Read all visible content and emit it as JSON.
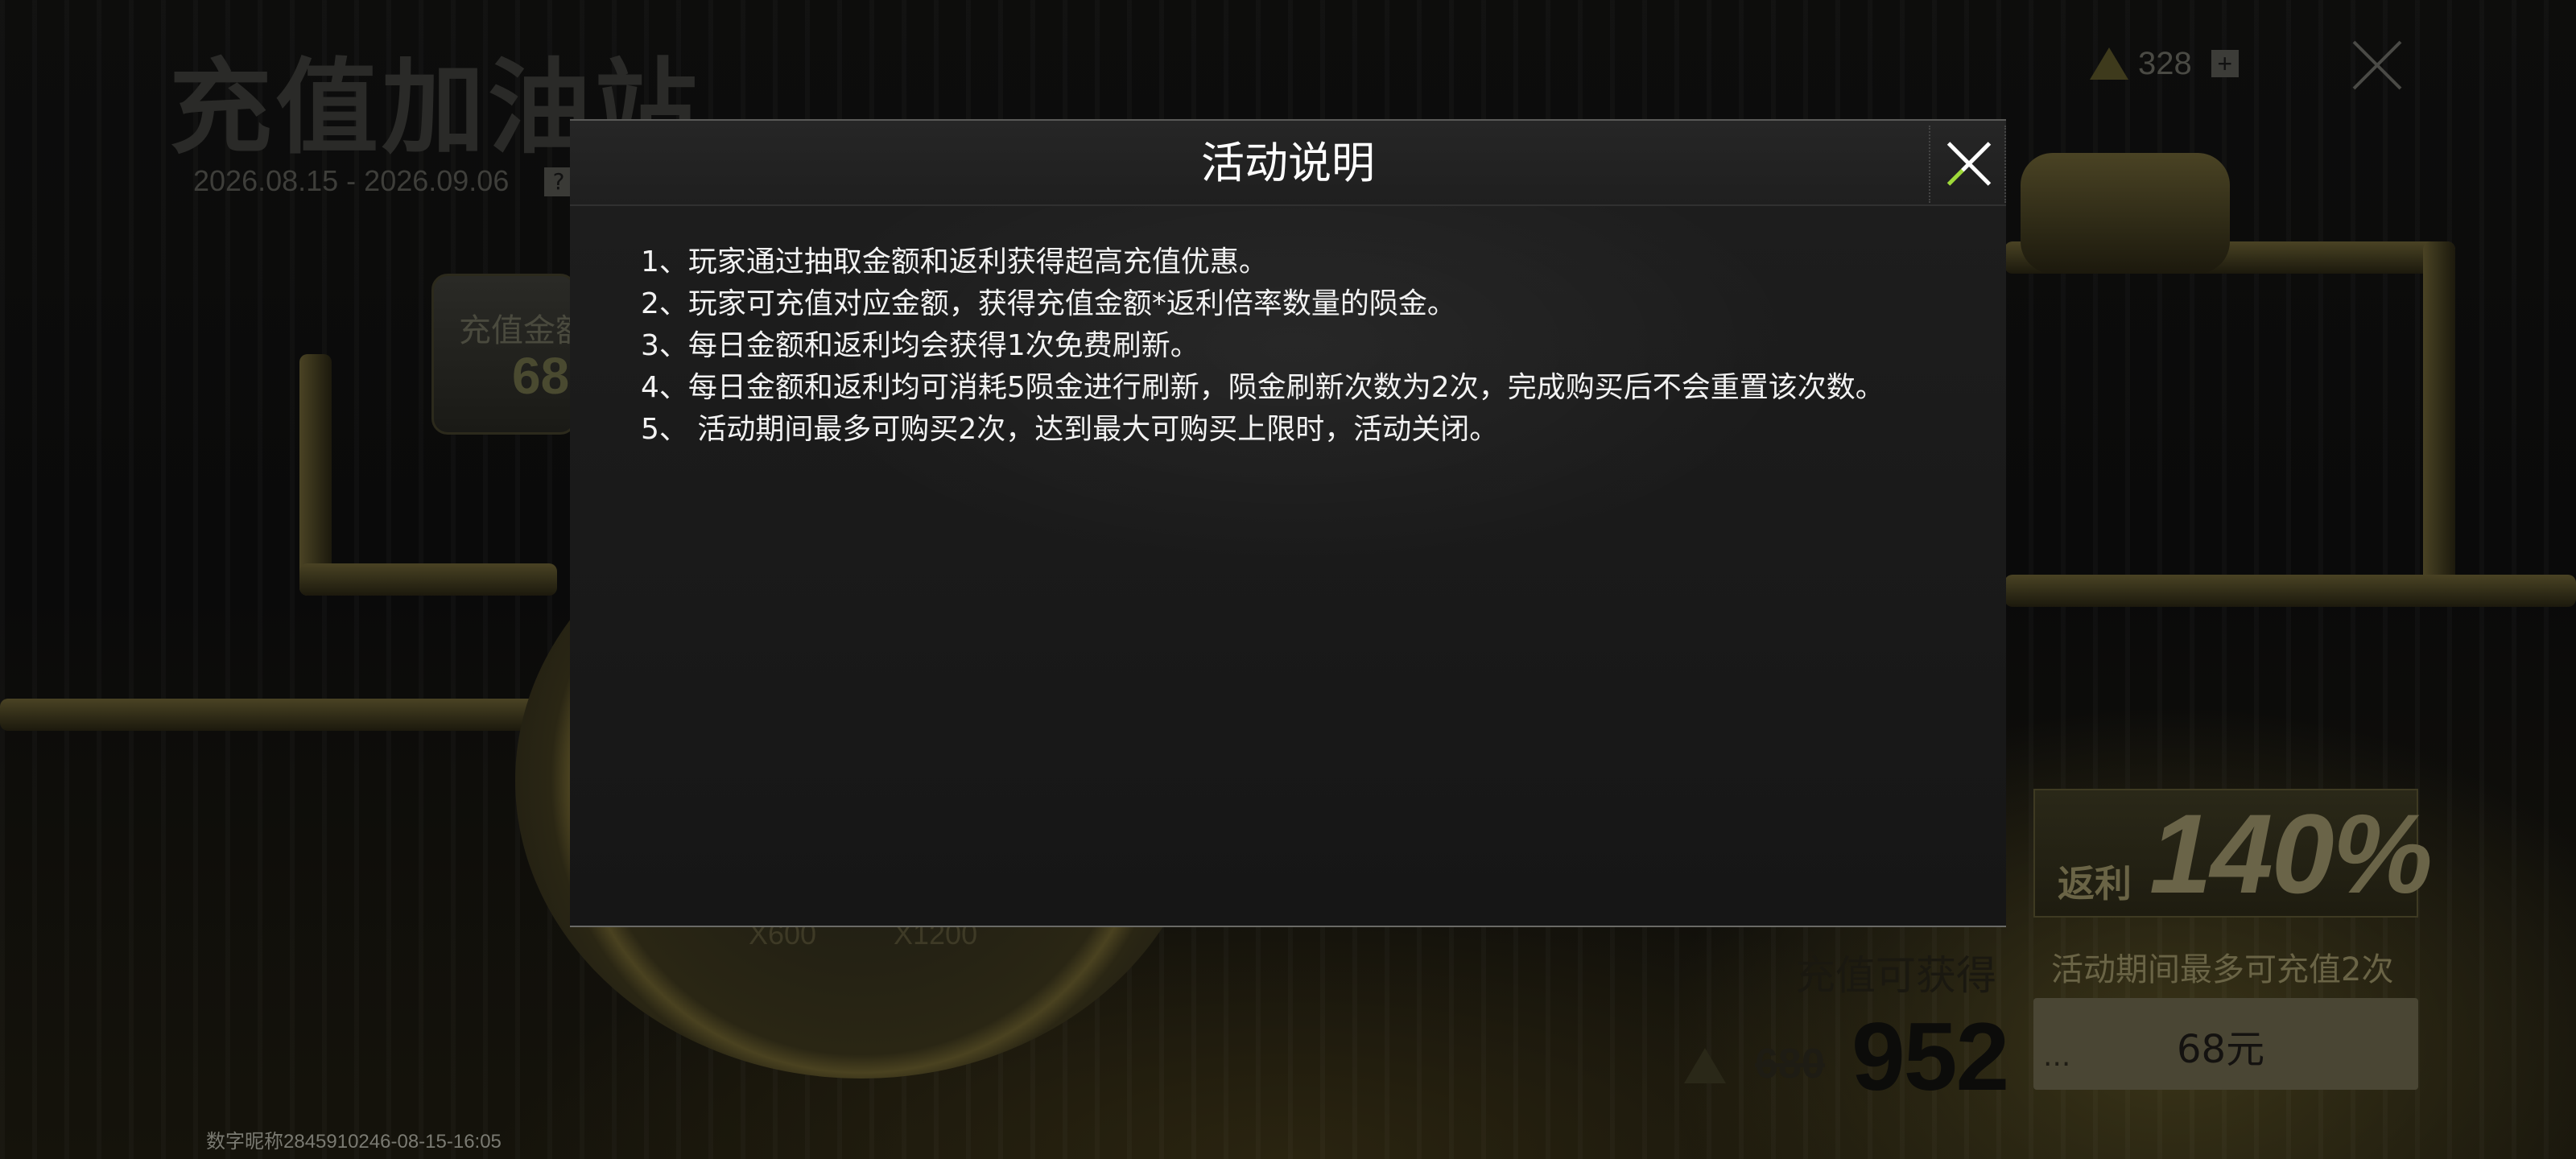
{
  "background": {
    "title": "充值加油站",
    "date_range": "2026.08.15 - 2026.09.06",
    "help_icon": "question-icon",
    "currency_amount": "328",
    "currency_icon": "meteorite-icon",
    "add_currency_icon": "plus-icon",
    "close_icon": "close-icon",
    "recharge_amount_label": "充值金额",
    "recharge_amount_value": "68",
    "gauge_segment_left": "X600",
    "gauge_segment_right": "X1200",
    "rebate_label": "返利",
    "rebate_percent": "140%",
    "limit_text": "活动期间最多可充值2次",
    "price_dots": "...",
    "price": "68元",
    "gain_label": "充值可获得",
    "old_value": "680",
    "new_value": "952",
    "watermark": "数字昵称2845910246-08-15-16:05"
  },
  "modal": {
    "title": "活动说明",
    "close_icon": "close-icon",
    "rules": [
      "1、玩家通过抽取金额和返利获得超高充值优惠。",
      "2、玩家可充值对应金额，获得充值金额*返利倍率数量的陨金。",
      "3、每日金额和返利均会获得1次免费刷新。",
      "4、每日金额和返利均可消耗5陨金进行刷新，陨金刷新次数为2次，完成购买后不会重置该次数。",
      "5、 活动期间最多可购买2次，达到最大可购买上限时，活动关闭。"
    ]
  },
  "colors": {
    "modal_bg": "#1a1a1a",
    "text": "#f2f2f2",
    "accent_green": "#9fd93a"
  }
}
